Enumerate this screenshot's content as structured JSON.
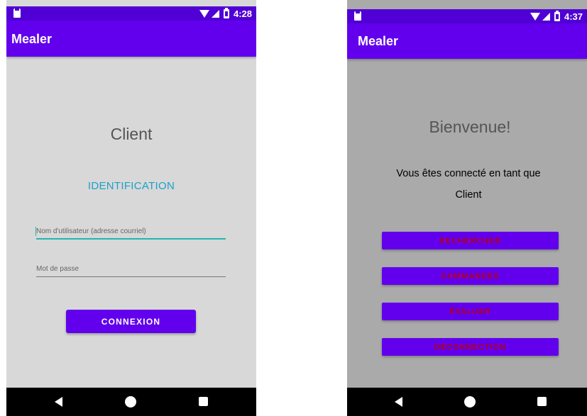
{
  "login_screen": {
    "status_bar": {
      "time": "4:28"
    },
    "app_bar": {
      "title": "Mealer"
    },
    "heading": "Client",
    "subheading": "IDENTIFICATION",
    "username_field": {
      "placeholder": "Nom d'utilisateur (adresse courriel)",
      "value": ""
    },
    "password_field": {
      "placeholder": "Mot de passe",
      "value": ""
    },
    "connect_button": "CONNEXION"
  },
  "home_screen": {
    "status_bar": {
      "time": "4:37"
    },
    "app_bar": {
      "title": "Mealer"
    },
    "heading": "Bienvenue!",
    "message_line1": "Vous êtes connecté en tant que",
    "message_line2": "Client",
    "buttons": {
      "search": "RECHERCHER",
      "orders": "COMMANDES",
      "rate": "ÉVALUER",
      "logout": "DÉCONNECTION"
    }
  },
  "colors": {
    "status_bar": "#5000d4",
    "app_bar": "#6200ee",
    "button": "#6200ee",
    "button_text_home": "#b8000e",
    "link_accent": "#1ba0c8",
    "field_focus": "#1fb8b0",
    "left_background": "#d8d8d8",
    "right_background": "#aaaaaa"
  }
}
